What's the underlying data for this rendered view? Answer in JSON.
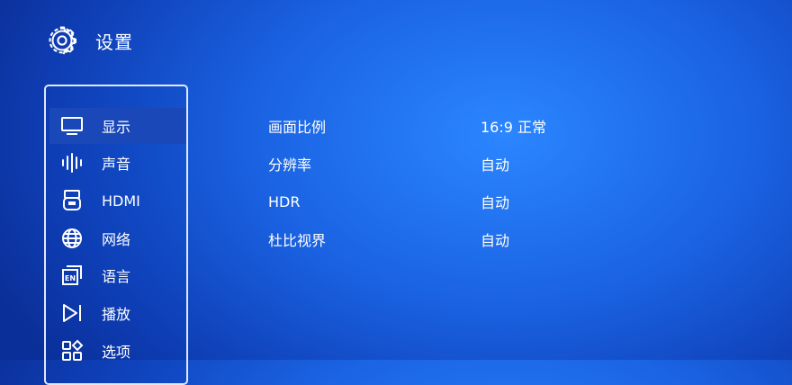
{
  "header": {
    "title": "设置",
    "icon": "gear-icon"
  },
  "menu": {
    "items": [
      {
        "label": "显示",
        "icon": "monitor-icon",
        "selected": true
      },
      {
        "label": "声音",
        "icon": "sound-wave-icon",
        "selected": false
      },
      {
        "label": "HDMI",
        "icon": "hdmi-port-icon",
        "selected": false
      },
      {
        "label": "网络",
        "icon": "globe-icon",
        "selected": false
      },
      {
        "label": "语言",
        "icon": "language-icon",
        "selected": false
      },
      {
        "label": "播放",
        "icon": "play-icon",
        "selected": false
      },
      {
        "label": "选项",
        "icon": "grid-options-icon",
        "selected": false
      }
    ]
  },
  "settings": [
    {
      "name": "画面比例",
      "value": "16:9 正常"
    },
    {
      "name": "分辨率",
      "value": "自动"
    },
    {
      "name": "HDR",
      "value": "自动"
    },
    {
      "name": "杜比视界",
      "value": "自动"
    }
  ],
  "colors": {
    "background": "#1a62e2",
    "selected_item": "#1a48b8",
    "text": "#ffffff"
  }
}
